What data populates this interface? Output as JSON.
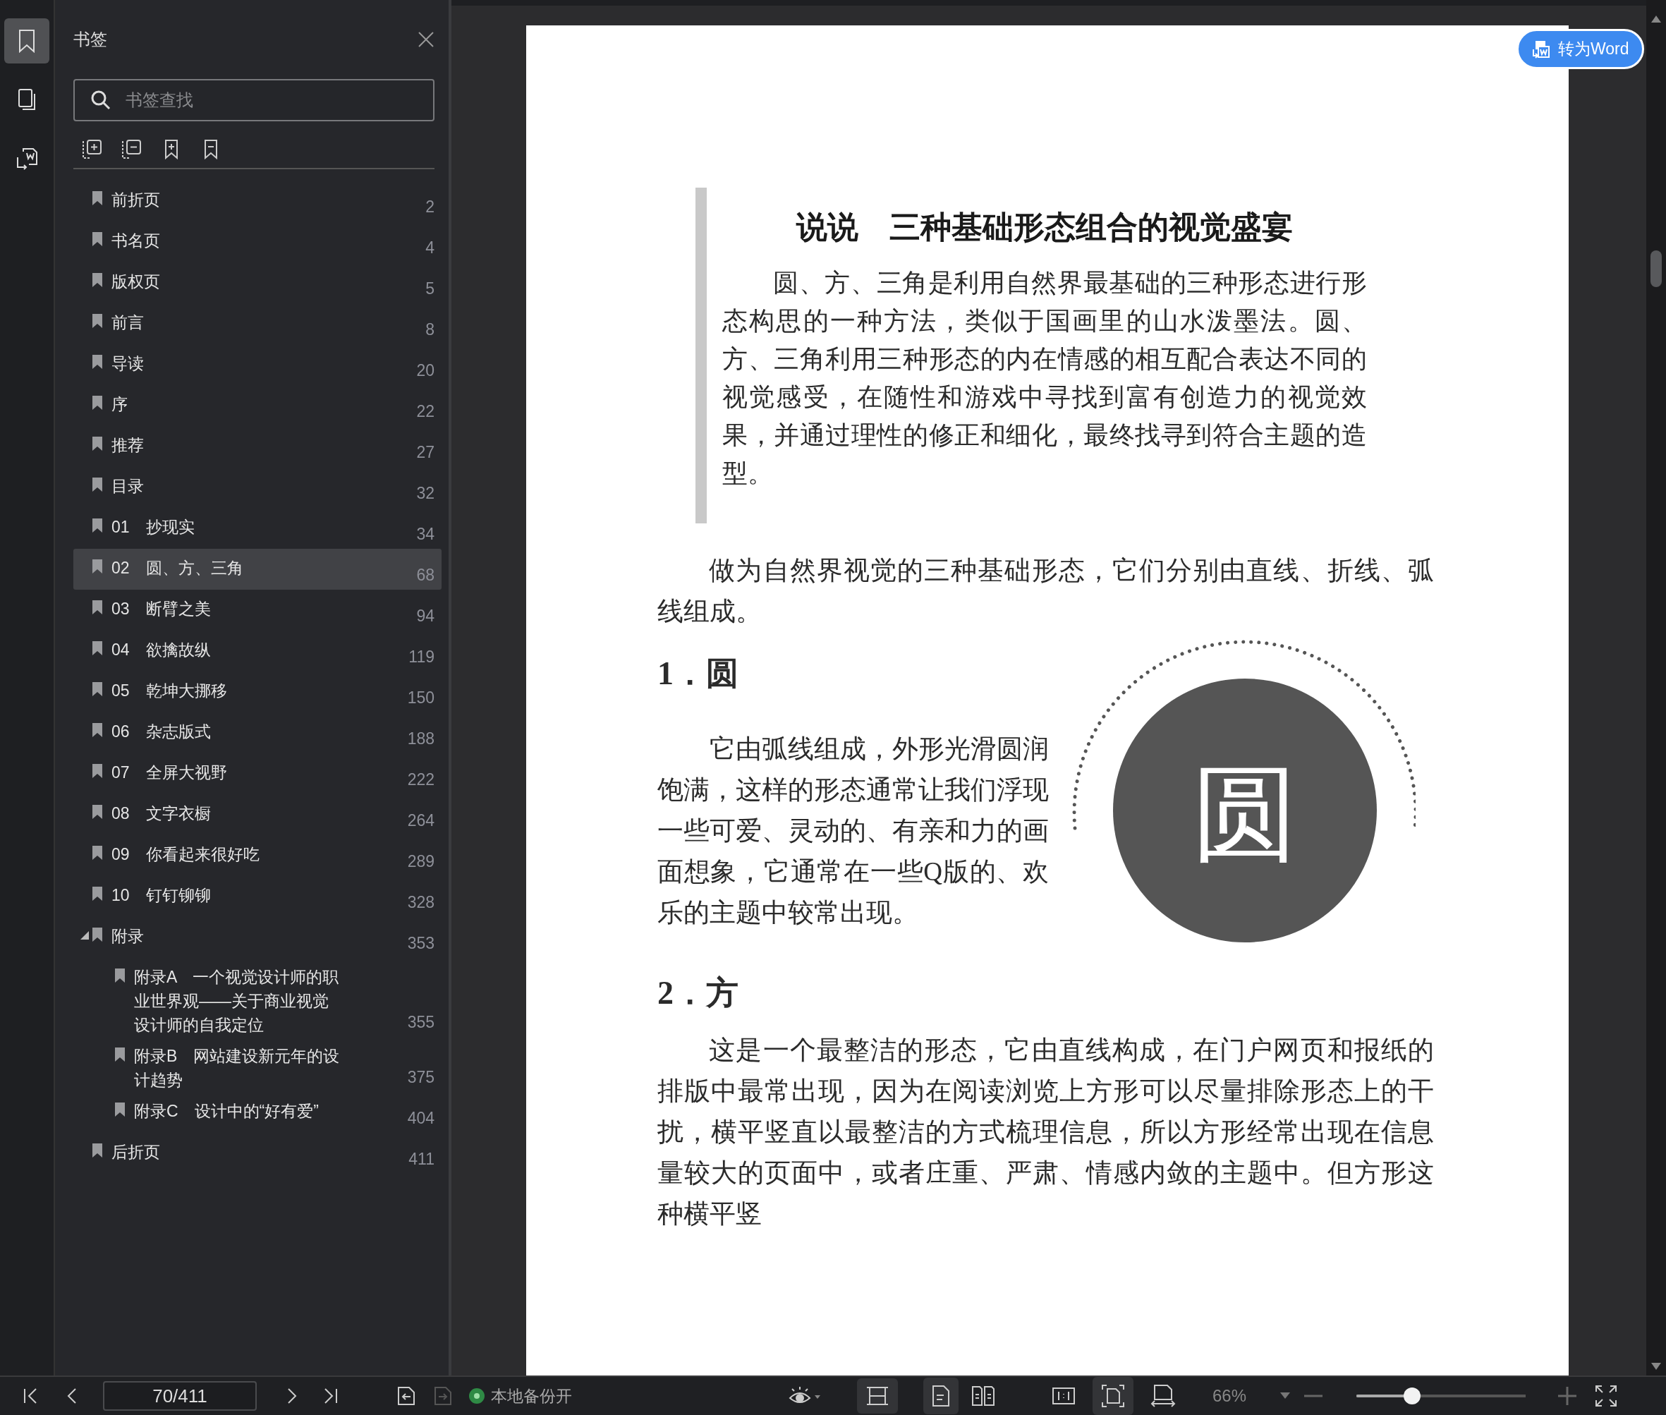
{
  "rail": [
    {
      "kind": "bookmarks",
      "selected": true
    },
    {
      "kind": "pages",
      "selected": false
    },
    {
      "kind": "convert",
      "selected": false
    }
  ],
  "sidebar": {
    "title": "书签",
    "search": {
      "placeholder": "书签查找"
    },
    "bookmarks": [
      {
        "label": "前折页",
        "page": "2",
        "selected": false
      },
      {
        "label": "书名页",
        "page": "4",
        "selected": false
      },
      {
        "label": "版权页",
        "page": "5",
        "selected": false
      },
      {
        "label": "前言",
        "page": "8",
        "selected": false
      },
      {
        "label": "导读",
        "page": "20",
        "selected": false
      },
      {
        "label": "序",
        "page": "22",
        "selected": false
      },
      {
        "label": "推荐",
        "page": "27",
        "selected": false
      },
      {
        "label": "目录",
        "page": "32",
        "selected": false
      },
      {
        "label": "01　抄现实",
        "page": "34",
        "selected": false
      },
      {
        "label": "02　圆、方、三角",
        "page": "68",
        "selected": true
      },
      {
        "label": "03　断臂之美",
        "page": "94",
        "selected": false
      },
      {
        "label": "04　欲擒故纵",
        "page": "119",
        "selected": false
      },
      {
        "label": "05　乾坤大挪移",
        "page": "150",
        "selected": false
      },
      {
        "label": "06　杂志版式",
        "page": "188",
        "selected": false
      },
      {
        "label": "07　全屏大视野",
        "page": "222",
        "selected": false
      },
      {
        "label": "08　文字衣橱",
        "page": "264",
        "selected": false
      },
      {
        "label": "09　你看起来很好吃",
        "page": "289",
        "selected": false
      },
      {
        "label": "10　钉钉铆铆",
        "page": "328",
        "selected": false
      },
      {
        "label": "附录",
        "page": "353",
        "selected": false,
        "expanded": true,
        "children": [
          {
            "label": "附录A　一个视觉设计师的职业世界观——关于商业视觉设计师的自我定位",
            "page": "355",
            "selected": false
          },
          {
            "label": "附录B　网站建设新元年的设计趋势",
            "page": "375",
            "selected": false
          },
          {
            "label": "附录C　设计中的“好有爱”",
            "page": "404",
            "selected": false
          }
        ]
      },
      {
        "label": "后折页",
        "page": "411",
        "selected": false
      }
    ]
  },
  "document": {
    "convert_button": "转为Word",
    "quote": {
      "title": "说说　三种基础形态组合的视觉盛宴",
      "body": "圆、方、三角是利用自然界最基础的三种形态进行形态构思的一种方法，类似于国画里的山水泼墨法。圆、方、三角利用三种形态的内在情感的相互配合表达不同的视觉感受，在随性和游戏中寻找到富有创造力的视觉效果，并通过理性的修正和细化，最终找寻到符合主题的造型。"
    },
    "intro": "做为自然界视觉的三种基础形态，它们分别由直线、折线、弧线组成。",
    "sections": [
      {
        "heading": "1．圆",
        "body": "它由弧线组成，外形光滑圆润饱满，这样的形态通常让我们浮现一些可爱、灵动的、有亲和力的画面想象，它通常在一些Q版的、欢乐的主题中较常出现。",
        "figure_char": "圆"
      },
      {
        "heading": "2．方",
        "body": "这是一个最整洁的形态，它由直线构成，在门户网页和报纸的排版中最常出现，因为在阅读浏览上方形可以尽量排除形态上的干扰，横平竖直以最整洁的方式梳理信息，所以方形经常出现在信息量较大的页面中，或者庄重、严肃、情感内敛的主题中。但方形这种横平竖"
      }
    ]
  },
  "status_bar": {
    "page": "70/411",
    "history": [
      {
        "kind": "back",
        "disabled": false
      },
      {
        "kind": "forward",
        "disabled": true
      }
    ],
    "backup": {
      "label": "本地备份开",
      "on": true
    },
    "view_buttons": [
      {
        "kind": "continuous",
        "on": true
      },
      {
        "kind": "single",
        "on": true
      },
      {
        "kind": "double",
        "on": false
      },
      {
        "kind": "actual-size",
        "on": false
      },
      {
        "kind": "fit-page",
        "on": true
      },
      {
        "kind": "fit-width",
        "on": false
      }
    ],
    "zoom": "66%",
    "zoom_slider": {
      "level": 0.33
    }
  }
}
